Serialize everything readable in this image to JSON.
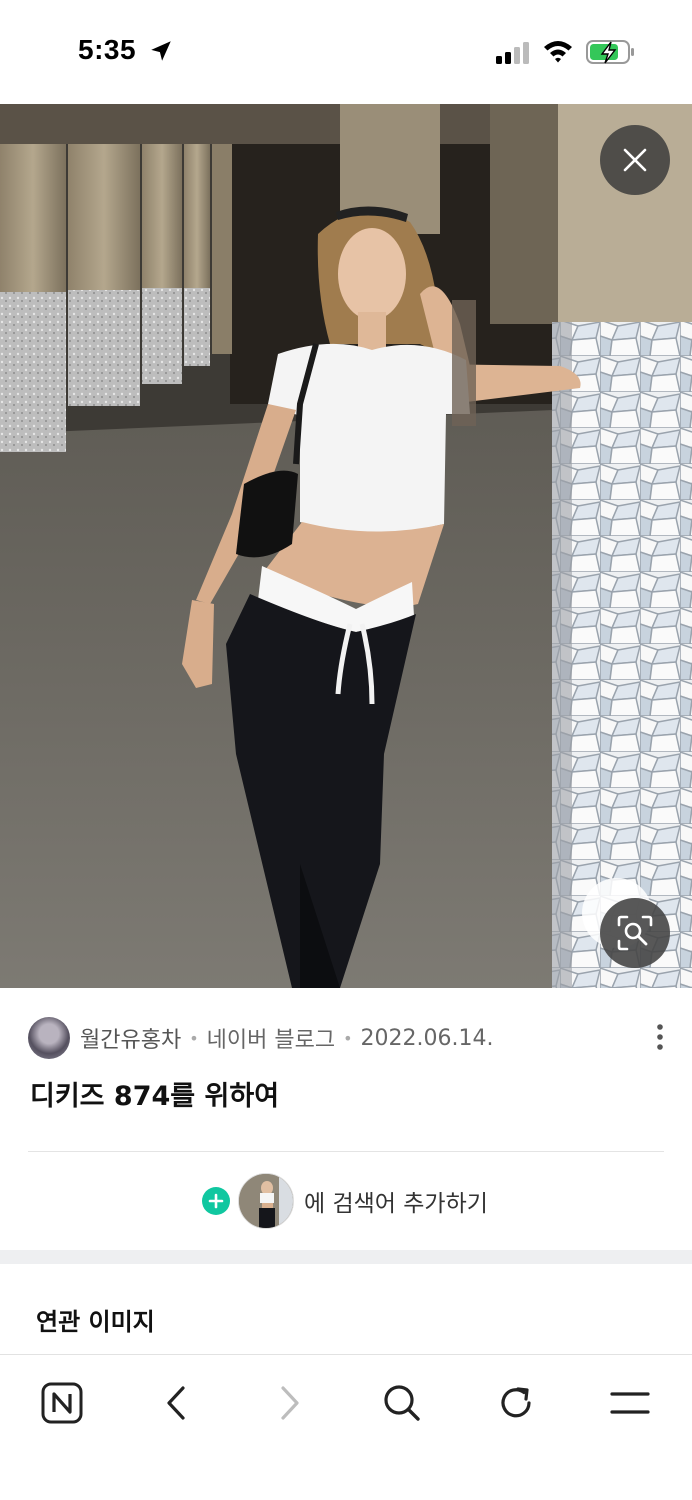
{
  "status_bar": {
    "time": "5:35"
  },
  "post": {
    "author": "월간유홍차",
    "source": "네이버 블로그",
    "date": "2022.06.14.",
    "dot": "•",
    "title": "디키즈 874를 위하여"
  },
  "add_search": {
    "label": "에 검색어 추가하기",
    "plus": "+"
  },
  "related": {
    "title": "연관 이미지"
  },
  "colors": {
    "accent_green": "#10c7a0"
  },
  "icons": {
    "close": "close-icon",
    "lens": "image-search-icon",
    "more": "more-vertical-icon",
    "home": "naver-n-icon",
    "back": "back-arrow-icon",
    "forward": "forward-arrow-icon",
    "search": "search-icon",
    "refresh": "refresh-icon",
    "menu": "menu-icon"
  }
}
